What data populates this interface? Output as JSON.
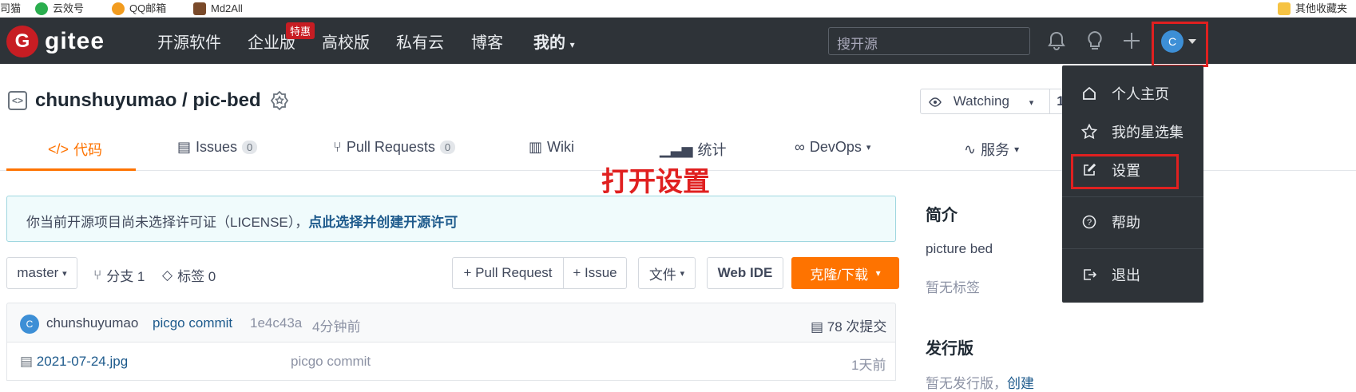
{
  "bookmarks": [
    "司猫",
    "云效号",
    "QQ邮箱",
    "Md2All",
    "其他收藏夹"
  ],
  "navbar": {
    "logo_text": "gitee",
    "items": [
      "开源软件",
      "企业版",
      "高校版",
      "私有云",
      "博客",
      "我的"
    ],
    "hot_badge": "特惠",
    "search_placeholder": "搜开源",
    "avatar_letter": "C"
  },
  "repo": {
    "title": "chunshuyumao / pic-bed",
    "watch_label": "Watching",
    "watch_count": "1"
  },
  "tabs": [
    {
      "label": "代码",
      "icon": "code-icon",
      "active": true
    },
    {
      "label": "Issues",
      "count": "0"
    },
    {
      "label": "Pull Requests",
      "count": "0"
    },
    {
      "label": "Wiki"
    },
    {
      "label": "统计"
    },
    {
      "label": "DevOps"
    },
    {
      "label": "服务"
    }
  ],
  "annotation": "打开设置",
  "license": {
    "text": "你当前开源项目尚未选择许可证（LICENSE），",
    "link": "点此选择并创建开源许可"
  },
  "toolbar": {
    "branch": "master",
    "branches": "分支 1",
    "tags": "标签 0",
    "pull_request": "+ Pull Request",
    "issue": "+ Issue",
    "file": "文件",
    "web_ide": "Web IDE",
    "clone": "克隆/下载"
  },
  "commit": {
    "author": "chunshuyumao",
    "message": "picgo commit",
    "hash": "1e4c43a",
    "time": "4分钟前",
    "count": "78 次提交"
  },
  "files": [
    {
      "name": "2021-07-24.jpg",
      "message": "picgo commit",
      "time": "1天前"
    }
  ],
  "sidebar": {
    "intro_title": "简介",
    "description": "picture bed",
    "no_tags": "暂无标签",
    "release_title": "发行版",
    "no_release": "暂无发行版，",
    "create": "创建"
  },
  "dropdown": {
    "items": [
      "个人主页",
      "我的星选集",
      "设置",
      "帮助",
      "退出"
    ]
  },
  "colors": {
    "accent": "#fe7300",
    "brand": "#c71d23",
    "highlight": "#e02020",
    "navbar": "#2e3338"
  }
}
